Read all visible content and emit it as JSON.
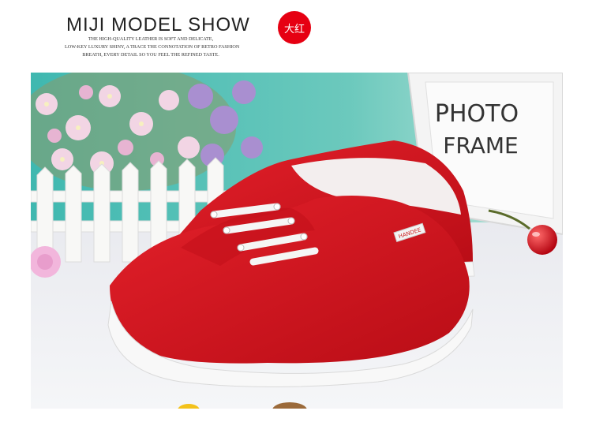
{
  "header": {
    "title": "MIJI MODEL SHOW",
    "subtitle_lines": [
      "THE HIGH-QUALITY LEATHER IS SOFT AND DELICATE,",
      "LOW-KEY LUXURY SHINY, A TRACE THE CONNOTATION OF RETRO FASHION",
      "BREATH, EVERY DETAIL SO YOU FEEL THE REFINED TASTE."
    ],
    "color_badge": "大红"
  },
  "photo": {
    "frame_text_line1": "PHOTO",
    "frame_text_line2": "FRAME",
    "shoe_tag": "HANDEE"
  },
  "colors": {
    "badge": "#e60012",
    "shoe": "#d8111b",
    "wall": "#4bbfb0"
  }
}
